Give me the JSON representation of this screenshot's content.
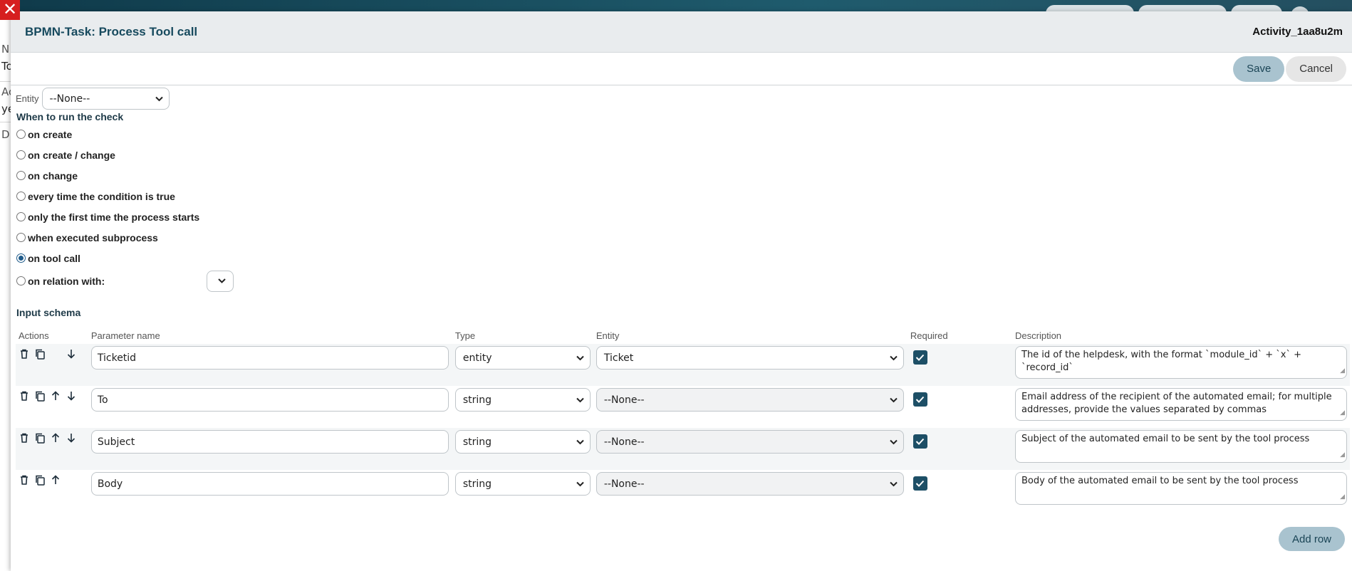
{
  "background": {
    "left_fragments": [
      "N",
      "To",
      "Ac",
      "ye",
      "D"
    ]
  },
  "close_label": "✕",
  "modal": {
    "title": "BPMN-Task: Process Tool call",
    "activity_id": "Activity_1aa8u2m"
  },
  "toolbar": {
    "save_label": "Save",
    "cancel_label": "Cancel"
  },
  "entity": {
    "label": "Entity",
    "value": "--None--"
  },
  "when_to_run": {
    "title": "When to run the check",
    "options": [
      {
        "label": "on create",
        "checked": false
      },
      {
        "label": "on create / change",
        "checked": false
      },
      {
        "label": "on change",
        "checked": false
      },
      {
        "label": "every time the condition is true",
        "checked": false
      },
      {
        "label": "only the first time the process starts",
        "checked": false
      },
      {
        "label": "when executed subprocess",
        "checked": false
      },
      {
        "label": "on tool call",
        "checked": true
      }
    ],
    "relation_label": "on relation with:",
    "relation_value": ""
  },
  "input_schema": {
    "title": "Input schema",
    "columns": {
      "actions": "Actions",
      "param": "Parameter name",
      "type": "Type",
      "entity": "Entity",
      "required": "Required",
      "description": "Description"
    },
    "rows": [
      {
        "param": "Ticketid",
        "type": "entity",
        "entity": "Ticket",
        "required": true,
        "description": "The id of the helpdesk, with the format `module_id` + `x` + `record_id`"
      },
      {
        "param": "To",
        "type": "string",
        "entity": "--None--",
        "required": true,
        "description": "Email address of the recipient of the automated email; for multiple addresses, provide the values separated by commas"
      },
      {
        "param": "Subject",
        "type": "string",
        "entity": "--None--",
        "required": true,
        "description": "Subject of the automated email to be sent by the tool process"
      },
      {
        "param": "Body",
        "type": "string",
        "entity": "--None--",
        "required": true,
        "description": "Body of the automated email to be sent by the tool process"
      }
    ],
    "add_row_label": "Add row"
  },
  "colors": {
    "header_bg": "#e9ecee",
    "title_color": "#174a5e",
    "primary_button": "#a9c3cf",
    "checkbox": "#1d4f66",
    "close": "#d61f1f"
  }
}
